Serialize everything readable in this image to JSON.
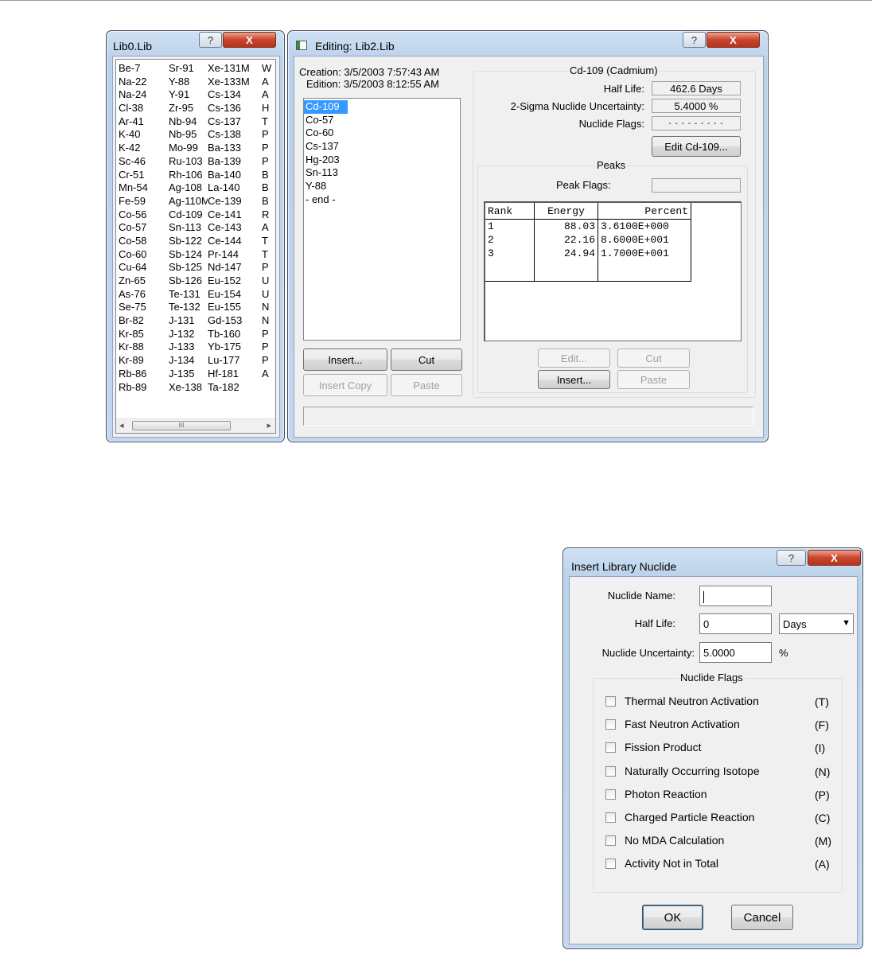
{
  "lib0": {
    "title": "Lib0.Lib",
    "help": "?",
    "close": "X",
    "rows": [
      [
        "Be-7",
        "Sr-91",
        "Xe-131M",
        "W"
      ],
      [
        "Na-22",
        "Y-88",
        "Xe-133M",
        "A"
      ],
      [
        "Na-24",
        "Y-91",
        "Cs-134",
        "A"
      ],
      [
        "Cl-38",
        "Zr-95",
        "Cs-136",
        "H"
      ],
      [
        "Ar-41",
        "Nb-94",
        "Cs-137",
        "T"
      ],
      [
        "K-40",
        "Nb-95",
        "Cs-138",
        "P"
      ],
      [
        "K-42",
        "Mo-99",
        "Ba-133",
        "P"
      ],
      [
        "Sc-46",
        "Ru-103",
        "Ba-139",
        "P"
      ],
      [
        "Cr-51",
        "Rh-106",
        "Ba-140",
        "B"
      ],
      [
        "Mn-54",
        "Ag-108",
        "La-140",
        "B"
      ],
      [
        "Fe-59",
        "Ag-110M",
        "Ce-139",
        "B"
      ],
      [
        "Co-56",
        "Cd-109",
        "Ce-141",
        "R"
      ],
      [
        "Co-57",
        "Sn-113",
        "Ce-143",
        "A"
      ],
      [
        "Co-58",
        "Sb-122",
        "Ce-144",
        "T"
      ],
      [
        "Co-60",
        "Sb-124",
        "Pr-144",
        "T"
      ],
      [
        "Cu-64",
        "Sb-125",
        "Nd-147",
        "P"
      ],
      [
        "Zn-65",
        "Sb-126",
        "Eu-152",
        "U"
      ],
      [
        "As-76",
        "Te-131",
        "Eu-154",
        "U"
      ],
      [
        "Se-75",
        "Te-132",
        "Eu-155",
        "N"
      ],
      [
        "Br-82",
        "J-131",
        "Gd-153",
        "N"
      ],
      [
        "Kr-85",
        "J-132",
        "Tb-160",
        "P"
      ],
      [
        "Kr-88",
        "J-133",
        "Yb-175",
        "P"
      ],
      [
        "Kr-89",
        "J-134",
        "Lu-177",
        "P"
      ],
      [
        "Rb-86",
        "J-135",
        "Hf-181",
        "A"
      ],
      [
        "Rb-89",
        "Xe-138",
        "Ta-182",
        ""
      ]
    ],
    "scroll_left": "◂",
    "scroll_thumb": "III",
    "scroll_right": "▸"
  },
  "editor": {
    "title": "Editing: Lib2.Lib",
    "help": "?",
    "close": "X",
    "creation": "Creation: 3/5/2003  7:57:43 AM",
    "edition": "Edition: 3/5/2003  8:12:55 AM",
    "nuclides": [
      "Cd-109",
      "Co-57",
      "Co-60",
      "Cs-137",
      "Hg-203",
      "Sn-113",
      "Y-88",
      "- end -"
    ],
    "buttons": {
      "insert": "Insert...",
      "cut": "Cut",
      "insert_copy": "Insert Copy",
      "paste": "Paste"
    },
    "detail": {
      "group_title": "Cd-109 (Cadmium)",
      "half_life_label": "Half Life:",
      "half_life_value": "462.6 Days",
      "uncertainty_label": "2-Sigma Nuclide Uncertainty:",
      "uncertainty_value": "5.4000 %",
      "flags_label": "Nuclide Flags:",
      "flags_value": "- - - - - - - - -",
      "edit_button": "Edit Cd-109..."
    },
    "peaks": {
      "group_title": "Peaks",
      "flags_label": "Peak Flags:",
      "headers": [
        "Rank",
        "Energy",
        "Percent"
      ],
      "rows": [
        [
          "1",
          "88.03",
          "3.6100E+000"
        ],
        [
          "2",
          "22.16",
          "8.6000E+001"
        ],
        [
          "3",
          "24.94",
          "1.7000E+001"
        ]
      ],
      "buttons": {
        "edit": "Edit...",
        "cut": "Cut",
        "insert": "Insert...",
        "paste": "Paste"
      }
    }
  },
  "insert_dialog": {
    "title": "Insert Library Nuclide",
    "help": "?",
    "close": "X",
    "name_label": "Nuclide Name:",
    "name_value": "",
    "half_life_label": "Half Life:",
    "half_life_value": "0",
    "unit_value": "Days",
    "unit_arrow": "▼",
    "uncertainty_label": "Nuclide Uncertainty:",
    "uncertainty_value": "5.0000",
    "percent": "%",
    "flags_title": "Nuclide Flags",
    "flags": [
      {
        "label": "Thermal Neutron Activation",
        "code": "(T)"
      },
      {
        "label": "Fast Neutron Activation",
        "code": "(F)"
      },
      {
        "label": "Fission Product",
        "code": "(I)"
      },
      {
        "label": "Naturally Occurring Isotope",
        "code": "(N)"
      },
      {
        "label": "Photon Reaction",
        "code": "(P)"
      },
      {
        "label": "Charged Particle Reaction",
        "code": "(C)"
      },
      {
        "label": "No MDA Calculation",
        "code": "(M)"
      },
      {
        "label": "Activity Not in Total",
        "code": "(A)"
      }
    ],
    "ok": "OK",
    "cancel": "Cancel"
  }
}
